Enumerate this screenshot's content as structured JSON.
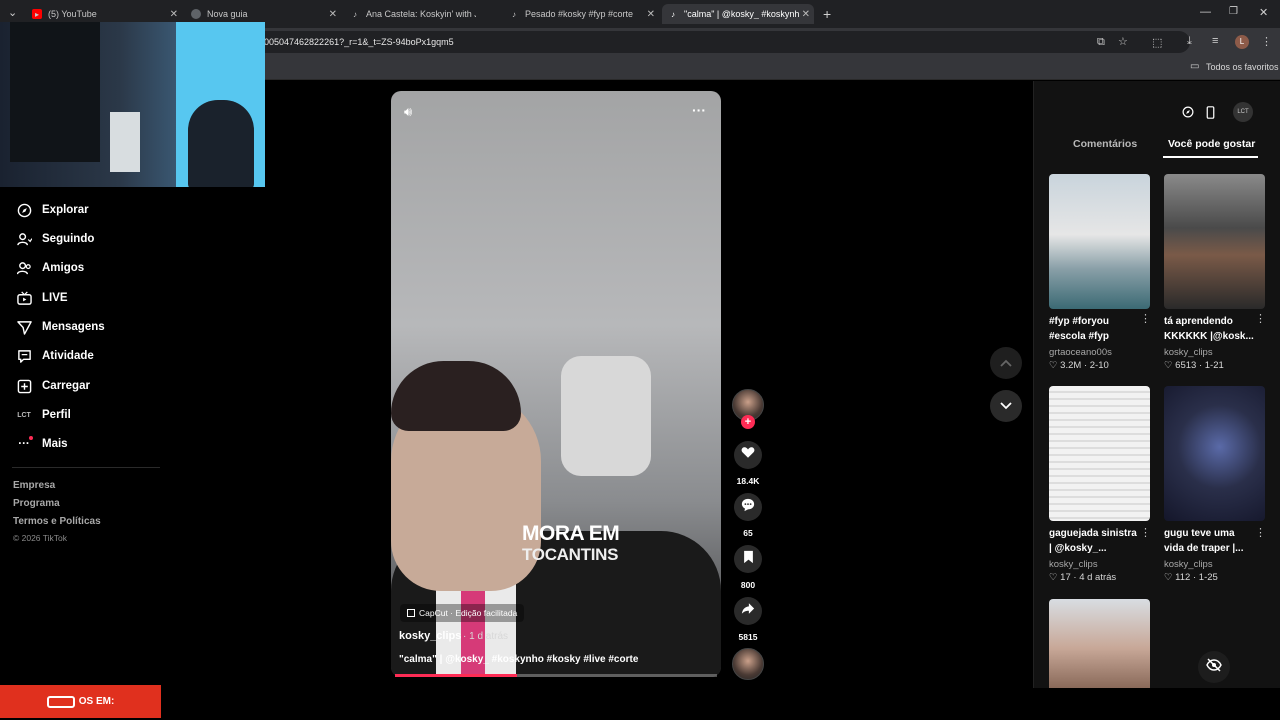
{
  "browser": {
    "tabs": [
      {
        "title": "(5) YouTube",
        "icon": "youtube-icon"
      },
      {
        "title": "Nova guia",
        "icon": "chrome-icon"
      },
      {
        "title": "Ana Castela: Koskyin' with Jon V",
        "icon": "tiktok-icon"
      },
      {
        "title": "Pesado #kosky #fyp #corte | ko",
        "icon": "tiktok-icon"
      },
      {
        "title": "\"calma\" | @kosky_ #koskynho #",
        "icon": "tiktok-icon"
      }
    ],
    "url": "005047462822261?_r=1&_t=ZS-94boPx1gqm5",
    "profile_initial": "L",
    "bookmarks_label": "Todos os favoritos"
  },
  "nav": {
    "items": [
      {
        "label": "Explorar",
        "icon": "compass-icon"
      },
      {
        "label": "Seguindo",
        "icon": "user-follow-icon"
      },
      {
        "label": "Amigos",
        "icon": "friends-icon"
      },
      {
        "label": "LIVE",
        "icon": "live-icon"
      },
      {
        "label": "Mensagens",
        "icon": "send-icon"
      },
      {
        "label": "Atividade",
        "icon": "activity-icon"
      },
      {
        "label": "Carregar",
        "icon": "upload-icon"
      },
      {
        "label": "Perfil",
        "icon": "profile-avatar-icon"
      },
      {
        "label": "Mais",
        "icon": "more-icon"
      }
    ],
    "footer_links": [
      "Empresa",
      "Programa",
      "Termos e Políticas"
    ],
    "copyright": "© 2026 TikTok",
    "banner_text": "OS EM:"
  },
  "video": {
    "caption_line1": "MORA EM",
    "caption_line2": "TOCANTINS",
    "capcut_label": "CapCut · Edição facilitada",
    "author": "kosky_clips",
    "time": "· 1 d atrás",
    "description": "\"calma\" | @kosky_ #koskynho #kosky #live #corte",
    "progress": 0.38,
    "likes": "18.4K",
    "comments": "65",
    "saves": "800",
    "shares": "5815"
  },
  "right_panel": {
    "tabs": [
      "Comentários",
      "Você pode gostar"
    ],
    "active_tab": 1,
    "videos": [
      {
        "title": "#fyp #foryou #escola #fyp",
        "author": "grtaoceano00s",
        "likes": "3.2M",
        "date": "2-10"
      },
      {
        "title": "tá aprendendo KKKKKK |@kosk...",
        "author": "kosky_clips",
        "likes": "6513",
        "date": "1-21"
      },
      {
        "title": "gaguejada sinistra | @kosky_...",
        "author": "kosky_clips",
        "likes": "17",
        "date": "4 d atrás"
      },
      {
        "title": "gugu teve uma vida de traper |...",
        "author": "kosky_clips",
        "likes": "112",
        "date": "1-25"
      }
    ]
  },
  "colors": {
    "accent": "#fe2c55",
    "banner": "#e0301e",
    "panel": "#121212"
  }
}
